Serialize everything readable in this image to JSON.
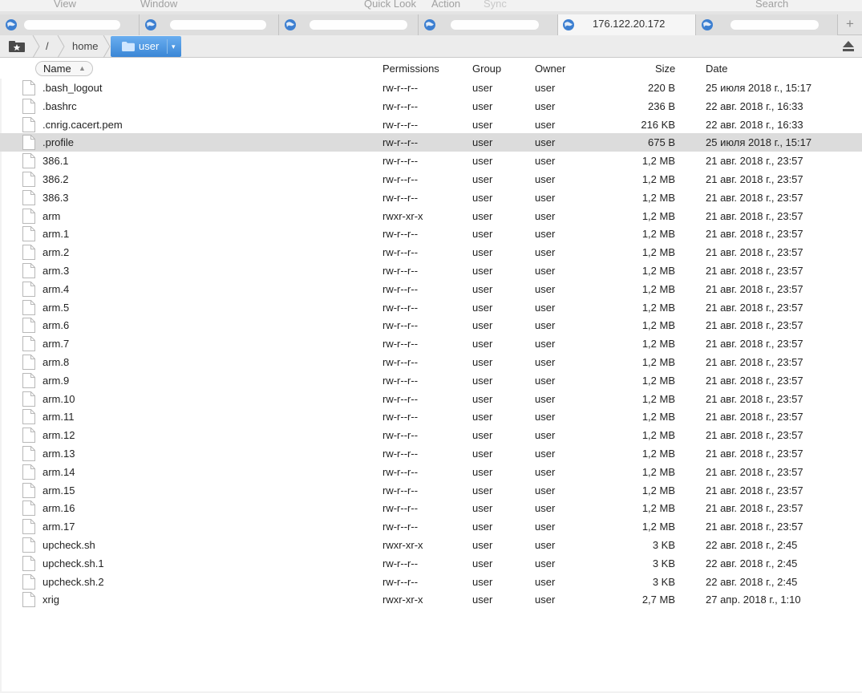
{
  "menu": {
    "view": "View",
    "window": "Window",
    "quick_look": "Quick Look",
    "action": "Action",
    "sync": "Sync",
    "search": "Search"
  },
  "tabs": [
    {
      "title": "",
      "icon": "globe-icon"
    },
    {
      "title": "",
      "icon": "globe-icon"
    },
    {
      "title": "",
      "icon": "globe-icon"
    },
    {
      "title": "",
      "icon": "globe-icon"
    },
    {
      "title": "176.122.20.172",
      "icon": "globe-icon",
      "active": true
    },
    {
      "title": "",
      "icon": "globe-icon"
    }
  ],
  "tab_add_label": "+",
  "path": {
    "root": "/",
    "home": "home",
    "current": "user",
    "dropdown_glyph": "▾"
  },
  "columns": {
    "name": "Name",
    "permissions": "Permissions",
    "group": "Group",
    "owner": "Owner",
    "size": "Size",
    "date": "Date"
  },
  "sort_indicator": "▲",
  "files": [
    {
      "name": ".bash_logout",
      "perm": "rw-r--r--",
      "group": "user",
      "owner": "user",
      "size": "220 B",
      "date": "25 июля 2018 г., 15:17"
    },
    {
      "name": ".bashrc",
      "perm": "rw-r--r--",
      "group": "user",
      "owner": "user",
      "size": "236 B",
      "date": "22 авг. 2018 г., 16:33"
    },
    {
      "name": ".cnrig.cacert.pem",
      "perm": "rw-r--r--",
      "group": "user",
      "owner": "user",
      "size": "216 KB",
      "date": "22 авг. 2018 г., 16:33"
    },
    {
      "name": ".profile",
      "perm": "rw-r--r--",
      "group": "user",
      "owner": "user",
      "size": "675 B",
      "date": "25 июля 2018 г., 15:17",
      "selected": true
    },
    {
      "name": "386.1",
      "perm": "rw-r--r--",
      "group": "user",
      "owner": "user",
      "size": "1,2 MB",
      "date": "21 авг. 2018 г., 23:57"
    },
    {
      "name": "386.2",
      "perm": "rw-r--r--",
      "group": "user",
      "owner": "user",
      "size": "1,2 MB",
      "date": "21 авг. 2018 г., 23:57"
    },
    {
      "name": "386.3",
      "perm": "rw-r--r--",
      "group": "user",
      "owner": "user",
      "size": "1,2 MB",
      "date": "21 авг. 2018 г., 23:57"
    },
    {
      "name": "arm",
      "perm": "rwxr-xr-x",
      "group": "user",
      "owner": "user",
      "size": "1,2 MB",
      "date": "21 авг. 2018 г., 23:57"
    },
    {
      "name": "arm.1",
      "perm": "rw-r--r--",
      "group": "user",
      "owner": "user",
      "size": "1,2 MB",
      "date": "21 авг. 2018 г., 23:57"
    },
    {
      "name": "arm.2",
      "perm": "rw-r--r--",
      "group": "user",
      "owner": "user",
      "size": "1,2 MB",
      "date": "21 авг. 2018 г., 23:57"
    },
    {
      "name": "arm.3",
      "perm": "rw-r--r--",
      "group": "user",
      "owner": "user",
      "size": "1,2 MB",
      "date": "21 авг. 2018 г., 23:57"
    },
    {
      "name": "arm.4",
      "perm": "rw-r--r--",
      "group": "user",
      "owner": "user",
      "size": "1,2 MB",
      "date": "21 авг. 2018 г., 23:57"
    },
    {
      "name": "arm.5",
      "perm": "rw-r--r--",
      "group": "user",
      "owner": "user",
      "size": "1,2 MB",
      "date": "21 авг. 2018 г., 23:57"
    },
    {
      "name": "arm.6",
      "perm": "rw-r--r--",
      "group": "user",
      "owner": "user",
      "size": "1,2 MB",
      "date": "21 авг. 2018 г., 23:57"
    },
    {
      "name": "arm.7",
      "perm": "rw-r--r--",
      "group": "user",
      "owner": "user",
      "size": "1,2 MB",
      "date": "21 авг. 2018 г., 23:57"
    },
    {
      "name": "arm.8",
      "perm": "rw-r--r--",
      "group": "user",
      "owner": "user",
      "size": "1,2 MB",
      "date": "21 авг. 2018 г., 23:57"
    },
    {
      "name": "arm.9",
      "perm": "rw-r--r--",
      "group": "user",
      "owner": "user",
      "size": "1,2 MB",
      "date": "21 авг. 2018 г., 23:57"
    },
    {
      "name": "arm.10",
      "perm": "rw-r--r--",
      "group": "user",
      "owner": "user",
      "size": "1,2 MB",
      "date": "21 авг. 2018 г., 23:57"
    },
    {
      "name": "arm.11",
      "perm": "rw-r--r--",
      "group": "user",
      "owner": "user",
      "size": "1,2 MB",
      "date": "21 авг. 2018 г., 23:57"
    },
    {
      "name": "arm.12",
      "perm": "rw-r--r--",
      "group": "user",
      "owner": "user",
      "size": "1,2 MB",
      "date": "21 авг. 2018 г., 23:57"
    },
    {
      "name": "arm.13",
      "perm": "rw-r--r--",
      "group": "user",
      "owner": "user",
      "size": "1,2 MB",
      "date": "21 авг. 2018 г., 23:57"
    },
    {
      "name": "arm.14",
      "perm": "rw-r--r--",
      "group": "user",
      "owner": "user",
      "size": "1,2 MB",
      "date": "21 авг. 2018 г., 23:57"
    },
    {
      "name": "arm.15",
      "perm": "rw-r--r--",
      "group": "user",
      "owner": "user",
      "size": "1,2 MB",
      "date": "21 авг. 2018 г., 23:57"
    },
    {
      "name": "arm.16",
      "perm": "rw-r--r--",
      "group": "user",
      "owner": "user",
      "size": "1,2 MB",
      "date": "21 авг. 2018 г., 23:57"
    },
    {
      "name": "arm.17",
      "perm": "rw-r--r--",
      "group": "user",
      "owner": "user",
      "size": "1,2 MB",
      "date": "21 авг. 2018 г., 23:57"
    },
    {
      "name": "upcheck.sh",
      "perm": "rwxr-xr-x",
      "group": "user",
      "owner": "user",
      "size": "3 KB",
      "date": "22 авг. 2018 г., 2:45"
    },
    {
      "name": "upcheck.sh.1",
      "perm": "rw-r--r--",
      "group": "user",
      "owner": "user",
      "size": "3 KB",
      "date": "22 авг. 2018 г., 2:45"
    },
    {
      "name": "upcheck.sh.2",
      "perm": "rw-r--r--",
      "group": "user",
      "owner": "user",
      "size": "3 KB",
      "date": "22 авг. 2018 г., 2:45"
    },
    {
      "name": "xrig",
      "perm": "rwxr-xr-x",
      "group": "user",
      "owner": "user",
      "size": "2,7 MB",
      "date": "27 апр. 2018 г., 1:10"
    }
  ],
  "colors": {
    "accent": "#3a86d6",
    "selected_row": "#dcdcdc",
    "globe": "#3c7fd1"
  }
}
